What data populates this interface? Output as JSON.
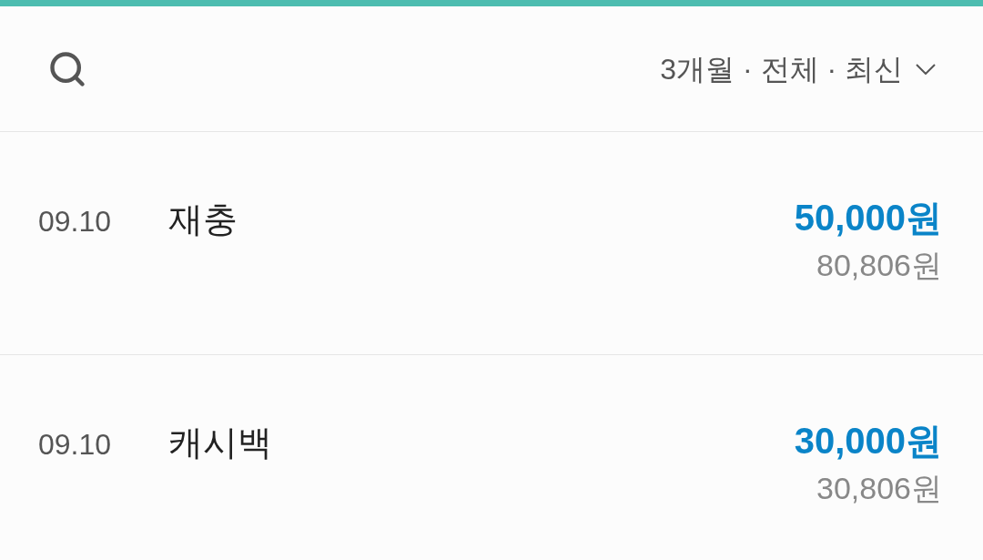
{
  "filter": {
    "label": "3개월 · 전체 · 최신"
  },
  "transactions": [
    {
      "date": "09.10",
      "title": "재충",
      "amount": "50,000원",
      "balance": "80,806원"
    },
    {
      "date": "09.10",
      "title": "캐시백",
      "amount": "30,000원",
      "balance": "30,806원"
    }
  ]
}
